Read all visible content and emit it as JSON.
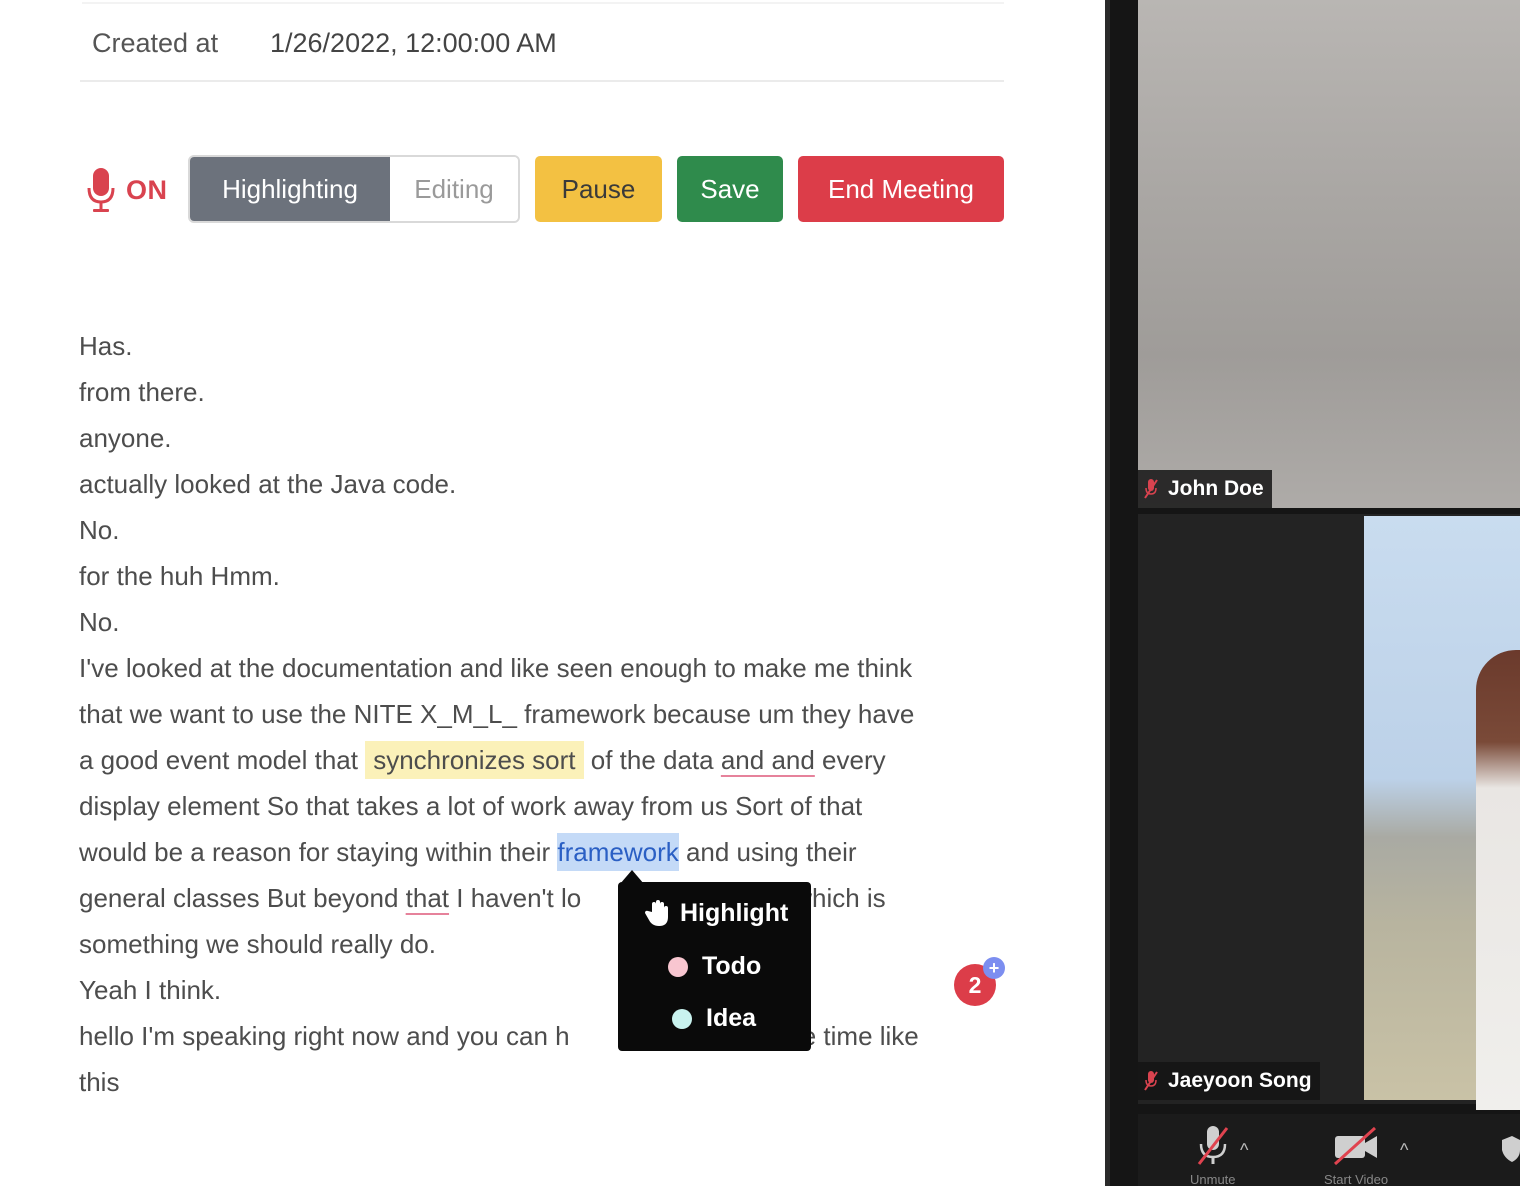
{
  "meeting": {
    "created_at_label": "Created at",
    "created_at_value": "1/26/2022, 12:00:00 AM"
  },
  "toolbar": {
    "mic_status": "ON",
    "mode_highlighting": "Highlighting",
    "mode_editing": "Editing",
    "pause_label": "Pause",
    "save_label": "Save",
    "end_meeting_label": "End Meeting"
  },
  "transcript": {
    "l1": "Has.",
    "l2": "from there.",
    "l3": "anyone.",
    "l4": "actually looked at the Java code.",
    "l5": "No.",
    "l6": "for the huh Hmm.",
    "l7": "No.",
    "l8": "I've looked at the documentation and like seen enough to make me think",
    "l9": "that we want to use the NITE X_M_L_ framework because um they have",
    "l10_a": "a good event model that ",
    "l10_hl": "synchronizes sort",
    "l10_b": " of the data ",
    "l10_ul": "and and",
    "l10_c": " every",
    "l11": "display element So that takes a lot of work away from us Sort of that",
    "l12_a": "would be a reason for staying within their ",
    "l12_hl": "framework",
    "l12_b": " and using their",
    "l13_a": "general classes But beyond ",
    "l13_ul": "that",
    "l13_b": " I haven't lo",
    "l13_c": "which is",
    "l14": "something we should really do.",
    "l15": "Yeah I think.",
    "l16_a": "hello I'm speaking right now and you can h",
    "l16_b": "ame time like",
    "l17": "this"
  },
  "highlight_menu": {
    "highlight": "Highlight",
    "todo": "Todo",
    "idea": "Idea"
  },
  "notification_count": "2",
  "notification_plus": "+",
  "video": {
    "participant_1": "John Doe",
    "participant_2": "Jaeyoon Song",
    "mic_label": "Unmute",
    "video_label": "Start Video"
  },
  "colors": {
    "accent_red": "#dc3d49",
    "pause_yellow": "#f3c142",
    "save_green": "#2f8b4c",
    "mode_gray": "#6c727c",
    "highlight_yellow": "#fbf1b9",
    "highlight_blue": "#c4daf7"
  },
  "icons": {
    "mic": "microphone-icon",
    "hand": "hand-pointer-icon",
    "muted_mic": "mic-muted-icon",
    "video_off": "video-off-icon"
  }
}
